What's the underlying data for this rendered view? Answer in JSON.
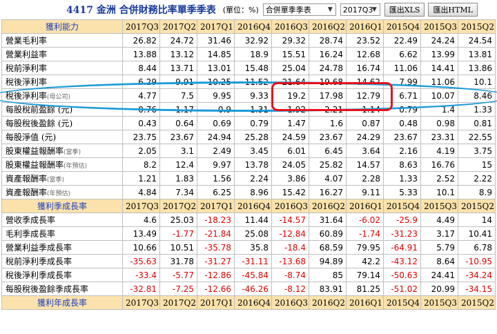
{
  "toolbar": {
    "title": "4417 金洲 合併財務比率單季季表",
    "unit": "(單位：%)",
    "report_select": "合併單季季表",
    "period_select": "2017Q3",
    "export_xls": "匯出XLS",
    "export_html": "匯出HTML"
  },
  "sections": [
    {
      "title": "獲利能力",
      "columns": [
        "2017Q3",
        "2017Q2",
        "2017Q1",
        "2016Q4",
        "2016Q3",
        "2016Q2",
        "2016Q1",
        "2015Q4",
        "2015Q3",
        "2015Q2"
      ],
      "rows": [
        {
          "label": "營業毛利率",
          "sub": "",
          "values": [
            "26.82",
            "24.72",
            "31.46",
            "32.92",
            "29.32",
            "28.74",
            "23.52",
            "22.49",
            "24.24",
            "24.54"
          ]
        },
        {
          "label": "營業利益率",
          "sub": "",
          "values": [
            "13.88",
            "13.12",
            "14.85",
            "18.9",
            "15.51",
            "16.24",
            "12.68",
            "6.62",
            "13.99",
            "13.81"
          ]
        },
        {
          "label": "稅前淨利率",
          "sub": "",
          "values": [
            "8.44",
            "13.71",
            "13.01",
            "15.48",
            "25.04",
            "24.78",
            "16.74",
            "11.06",
            "14.41",
            "13.86"
          ]
        },
        {
          "label": "稅後淨利率",
          "sub": "",
          "values": [
            "6.29",
            "9.91",
            "10.25",
            "11.52",
            "21.64",
            "19.68",
            "14.62",
            "7.99",
            "11.06",
            "10.1"
          ]
        },
        {
          "label": "稅後淨利率",
          "sub": "(母公司)",
          "values": [
            "4.77",
            "7.5",
            "9.95",
            "9.33",
            "19.2",
            "17.98",
            "12.79",
            "6.71",
            "10.07",
            "8.46"
          ]
        },
        {
          "label": "每股稅前盈餘 (元)",
          "sub": "",
          "values": [
            "0.76",
            "1.17",
            "0.9",
            "1.31",
            "1.92",
            "2.21",
            "1.14",
            "0.79",
            "1.4",
            "1.33"
          ]
        },
        {
          "label": "每股稅後盈餘 (元)",
          "sub": "",
          "values": [
            "0.43",
            "0.64",
            "0.69",
            "0.79",
            "1.47",
            "1.6",
            "0.87",
            "0.48",
            "0.98",
            "0.81"
          ]
        },
        {
          "label": "每股淨值 (元)",
          "sub": "",
          "values": [
            "23.75",
            "23.67",
            "24.94",
            "25.28",
            "24.59",
            "23.67",
            "24.29",
            "23.67",
            "23.31",
            "22.55"
          ]
        },
        {
          "label": "股東權益報酬率",
          "sub": "(當季)",
          "values": [
            "2.05",
            "3.1",
            "2.49",
            "3.45",
            "6.01",
            "6.45",
            "3.64",
            "2.16",
            "4.19",
            "3.75"
          ]
        },
        {
          "label": "股東權益報酬率",
          "sub": "(年預估)",
          "values": [
            "8.2",
            "12.4",
            "9.97",
            "13.78",
            "24.05",
            "25.82",
            "14.57",
            "8.63",
            "16.76",
            "15"
          ]
        },
        {
          "label": "資產報酬率",
          "sub": "(當季)",
          "values": [
            "1.21",
            "1.83",
            "1.56",
            "2.24",
            "3.86",
            "4.07",
            "2.28",
            "1.33",
            "2.52",
            "2.22"
          ]
        },
        {
          "label": "資產報酬率",
          "sub": "(年預估)",
          "values": [
            "4.84",
            "7.34",
            "6.25",
            "8.96",
            "15.42",
            "16.27",
            "9.11",
            "5.33",
            "10.1",
            "8.9"
          ]
        }
      ]
    },
    {
      "title": "獲利季成長率",
      "columns": [
        "2017Q3",
        "2017Q2",
        "2017Q1",
        "2016Q4",
        "2016Q3",
        "2016Q2",
        "2016Q1",
        "2015Q4",
        "2015Q3",
        "2015Q2"
      ],
      "rows": [
        {
          "label": "營收季成長率",
          "sub": "",
          "values": [
            "4.6",
            "25.03",
            "-18.23",
            "11.44",
            "-14.57",
            "31.64",
            "-6.02",
            "-25.9",
            "4.49",
            "14"
          ]
        },
        {
          "label": "毛利季成長率",
          "sub": "",
          "values": [
            "13.49",
            "-1.77",
            "-21.84",
            "25.08",
            "-12.84",
            "60.89",
            "-1.74",
            "-31.23",
            "3.17",
            "10.41"
          ]
        },
        {
          "label": "營業利益季成長率",
          "sub": "",
          "values": [
            "10.66",
            "10.51",
            "-35.78",
            "35.8",
            "-18.4",
            "68.59",
            "79.95",
            "-64.91",
            "5.79",
            "6.78"
          ]
        },
        {
          "label": "稅前淨利季成長率",
          "sub": "",
          "values": [
            "-35.63",
            "31.78",
            "-31.27",
            "-31.11",
            "-13.68",
            "94.89",
            "42.2",
            "-43.12",
            "8.64",
            "-10.95"
          ]
        },
        {
          "label": "稅後淨利季成長率",
          "sub": "",
          "values": [
            "-33.4",
            "-5.77",
            "-12.86",
            "-45.84",
            "-8.74",
            "85",
            "79.14",
            "-50.63",
            "24.41",
            "-34.24"
          ]
        },
        {
          "label": "每股稅後盈餘季成長率",
          "sub": "",
          "values": [
            "-32.81",
            "-7.25",
            "-12.66",
            "-46.26",
            "-8.12",
            "83.91",
            "81.25",
            "-51.02",
            "20.99",
            "-34.15"
          ]
        }
      ]
    },
    {
      "title": "獲利年成長率",
      "columns": [
        "2017Q3",
        "2017Q2",
        "2017Q1",
        "2016Q4",
        "2016Q3",
        "2016Q2",
        "2016Q1",
        "2015Q4",
        "2015Q3",
        "2015Q2"
      ],
      "rows": []
    }
  ]
}
